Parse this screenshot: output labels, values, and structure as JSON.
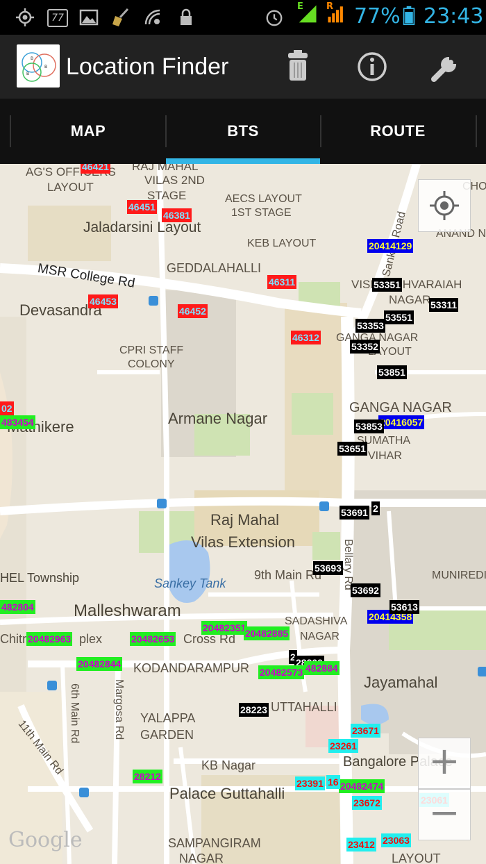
{
  "status_bar": {
    "icons": [
      "gps-icon",
      "notification-77-icon",
      "image-icon",
      "broom-icon",
      "wifi-icon",
      "lock-icon",
      "alarm-icon",
      "signal-e-icon",
      "signal-r-icon",
      "battery-icon"
    ],
    "network_e": "E",
    "network_r": "R",
    "battery": "77%",
    "time": "23:43",
    "badge": "77"
  },
  "action_bar": {
    "title": "Location Finder",
    "actions": [
      "trash-icon",
      "info-icon",
      "wrench-icon"
    ]
  },
  "tabs": [
    {
      "label": "MAP",
      "selected": false
    },
    {
      "label": "BTS",
      "selected": true
    },
    {
      "label": "ROUTE",
      "selected": false
    }
  ],
  "map": {
    "place_labels": [
      "AG'S OFFICERS",
      "LAYOUT",
      "RAJ MAHAL",
      "VILAS 2ND",
      "STAGE",
      "AECS LAYOUT",
      "1ST STAGE",
      "Jaladarsini Layout",
      "KEB LAYOUT",
      "CHOLA",
      "ANAND NA",
      "MSR College Rd",
      "GEDDALAHALLI",
      "VISHVESHVARAIAH",
      "NAGAR",
      "Devasandra",
      "GANGA NAGAR",
      "LAYOUT",
      "CPRI STAFF",
      "COLONY",
      "GANGA NAGAR",
      "Armane Nagar",
      "Mathikere",
      "SUMATHA",
      "VIHAR",
      "Raj Mahal",
      "Vilas Extension",
      "Bellary Rd",
      "Sankey Tank",
      "9th Main Rd",
      "HEL Township",
      "MUNIREDI",
      "Malleshwaram",
      "SADASHIVA",
      "NAGAR",
      "Chitrap",
      "plex",
      "Cross Rd",
      "KODANDARAMPUR",
      "Jayamahal",
      "6th Main Rd",
      "Margosa Rd",
      "11th Main Rd",
      "YALAPPA",
      "GARDEN",
      "UTTAHALLI",
      "KB Nagar",
      "Bangalore Palace",
      "Palace Guttahalli",
      "SAMPANGIRAM",
      "NAGAR",
      "LAYOUT",
      "Sankey Road"
    ],
    "bts_labels": [
      {
        "text": "46421",
        "color": "red"
      },
      {
        "text": "46451",
        "color": "red"
      },
      {
        "text": "46381",
        "color": "red"
      },
      {
        "text": "46311",
        "color": "red"
      },
      {
        "text": "46453",
        "color": "red"
      },
      {
        "text": "46452",
        "color": "red"
      },
      {
        "text": "46312",
        "color": "red"
      },
      {
        "text": "20414129",
        "color": "blue"
      },
      {
        "text": "20416057",
        "color": "blue"
      },
      {
        "text": "20414358",
        "color": "blue"
      },
      {
        "text": "53351",
        "color": "black"
      },
      {
        "text": "53311",
        "color": "black"
      },
      {
        "text": "53551",
        "color": "black"
      },
      {
        "text": "53353",
        "color": "black"
      },
      {
        "text": "53352",
        "color": "black"
      },
      {
        "text": "53851",
        "color": "black"
      },
      {
        "text": "53853",
        "color": "black"
      },
      {
        "text": "53651",
        "color": "black"
      },
      {
        "text": "53691",
        "color": "black"
      },
      {
        "text": "2",
        "color": "black"
      },
      {
        "text": "53693",
        "color": "black"
      },
      {
        "text": "53692",
        "color": "black"
      },
      {
        "text": "53613",
        "color": "black"
      },
      {
        "text": "28223",
        "color": "black"
      },
      {
        "text": "2",
        "color": "black"
      },
      {
        "text": "28200",
        "color": "black"
      },
      {
        "text": "02",
        "color": "red"
      },
      {
        "text": "483454",
        "color": "green"
      },
      {
        "text": "482804",
        "color": "green"
      },
      {
        "text": "20482963",
        "color": "green"
      },
      {
        "text": "20482653",
        "color": "green"
      },
      {
        "text": "20482351",
        "color": "green"
      },
      {
        "text": "20482885",
        "color": "green"
      },
      {
        "text": "20482844",
        "color": "green"
      },
      {
        "text": "20482573",
        "color": "green"
      },
      {
        "text": "482884",
        "color": "green"
      },
      {
        "text": "28212",
        "color": "green"
      },
      {
        "text": "20482474",
        "color": "green"
      },
      {
        "text": "23671",
        "color": "cyan"
      },
      {
        "text": "23261",
        "color": "cyan"
      },
      {
        "text": "23391",
        "color": "cyan"
      },
      {
        "text": "16",
        "color": "cyan"
      },
      {
        "text": "23672",
        "color": "cyan"
      },
      {
        "text": "23061",
        "color": "cyan"
      },
      {
        "text": "23412",
        "color": "cyan"
      },
      {
        "text": "23063",
        "color": "cyan"
      }
    ],
    "watermark": "Google",
    "controls": [
      "my-location-icon",
      "zoom-in-icon",
      "zoom-out-icon"
    ]
  }
}
